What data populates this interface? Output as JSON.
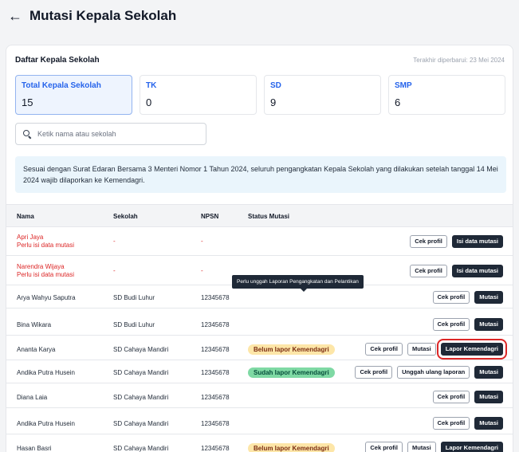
{
  "header": {
    "back_icon": "arrow-left-icon",
    "title": "Mutasi Kepala Sekolah"
  },
  "card": {
    "title": "Daftar Kepala Sekolah",
    "updated": "Terakhir diperbarui: 23 Mei 2024"
  },
  "stats": [
    {
      "label": "Total Kepala Sekolah",
      "value": "15"
    },
    {
      "label": "TK",
      "value": "0"
    },
    {
      "label": "SD",
      "value": "9"
    },
    {
      "label": "SMP",
      "value": "6"
    }
  ],
  "search": {
    "placeholder": "Ketik nama atau sekolah",
    "icon": "search-icon"
  },
  "info": "Sesuai dengan Surat Edaran Bersama 3 Menteri Nomor 1 Tahun 2024, seluruh pengangkatan Kepala Sekolah yang dilakukan setelah tanggal 14 Mei 2024 wajib dilaporkan ke Kemendagri.",
  "table": {
    "headers": [
      "Nama",
      "Sekolah",
      "NPSN",
      "Status Mutasi"
    ],
    "rows": [
      {
        "name": "Apri Jaya",
        "sub": "Perlu isi data mutasi",
        "school": "-",
        "npsn": "-",
        "status": "",
        "actions": [
          "Cek profil",
          "Isi data mutasi"
        ]
      },
      {
        "name": "Narendra Wijaya",
        "sub": "Perlu isi data mutasi",
        "school": "-",
        "npsn": "-",
        "status": "",
        "actions": [
          "Cek profil",
          "Isi data mutasi"
        ]
      },
      {
        "name": "Arya Wahyu Saputra",
        "sub": "",
        "school": "SD Budi Luhur",
        "npsn": "12345678",
        "status": "",
        "actions": [
          "Cek profil",
          "Mutasi"
        ]
      },
      {
        "name": "Bina Wikara",
        "sub": "",
        "school": "SD Budi Luhur",
        "npsn": "12345678",
        "status": "",
        "actions": [
          "Cek profil",
          "Mutasi"
        ]
      },
      {
        "name": "Ananta Karya",
        "sub": "",
        "school": "SD Cahaya Mandiri",
        "npsn": "12345678",
        "status": "Belum lapor Kemendagri",
        "actions": [
          "Cek profil",
          "Mutasi",
          "Lapor Kemendagri"
        ]
      },
      {
        "name": "Andika Putra Husein",
        "sub": "",
        "school": "SD Cahaya Mandiri",
        "npsn": "12345678",
        "status": "Sudah lapor Kemendagri",
        "actions": [
          "Cek profil",
          "Unggah ulang laporan",
          "Mutasi"
        ]
      },
      {
        "name": "Diana Laia",
        "sub": "",
        "school": "SD Cahaya Mandiri",
        "npsn": "12345678",
        "status": "",
        "actions": [
          "Cek profil",
          "Mutasi"
        ]
      },
      {
        "name": "Andika Putra Husein",
        "sub": "",
        "school": "SD Cahaya Mandiri",
        "npsn": "12345678",
        "status": "",
        "actions": [
          "Cek profil",
          "Mutasi"
        ]
      },
      {
        "name": "Hasan Basri",
        "sub": "",
        "school": "SD Cahaya Mandiri",
        "npsn": "12345678",
        "status": "Belum lapor Kemendagri",
        "actions": [
          "Cek profil",
          "Mutasi",
          "Lapor Kemendagri"
        ]
      }
    ]
  },
  "tooltip": "Perlu unggah Laporan Pengangkatan dan Pelantikan",
  "colors": {
    "accent": "#2563eb",
    "error": "#dc2626",
    "warning_badge": "#fde6a8",
    "success_badge": "#7fd9a4",
    "dark_button": "#1f2937"
  }
}
